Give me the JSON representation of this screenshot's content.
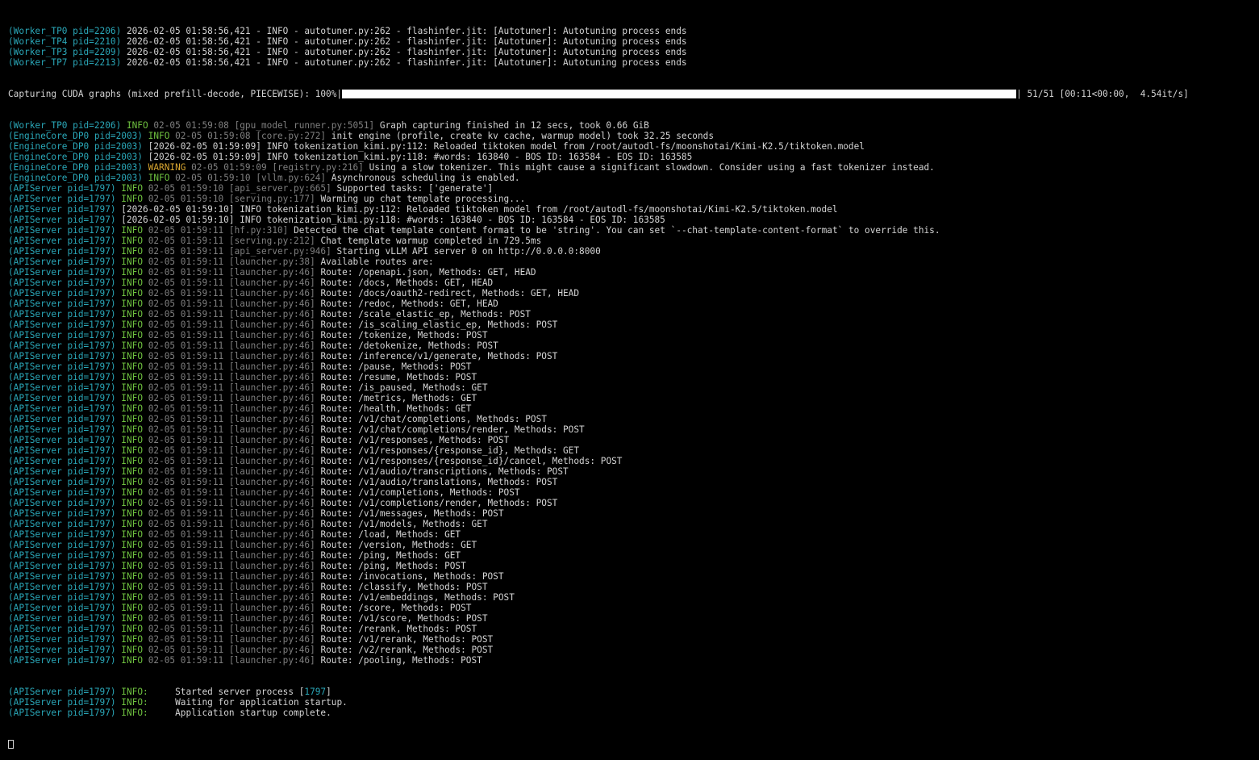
{
  "colors": {
    "background": "#000000",
    "text": "#d4d4d4",
    "source": "#2aa7b8",
    "info": "#6ec13f",
    "warning": "#d7a530",
    "dim": "#7f7f7f"
  },
  "worker_lines": [
    {
      "src": "(Worker_TP0 pid=2206)",
      "msg": " 2026-02-05 01:58:56,421 - INFO - autotuner.py:262 - flashinfer.jit: [Autotuner]: Autotuning process ends"
    },
    {
      "src": "(Worker_TP4 pid=2210)",
      "msg": " 2026-02-05 01:58:56,421 - INFO - autotuner.py:262 - flashinfer.jit: [Autotuner]: Autotuning process ends"
    },
    {
      "src": "(Worker_TP3 pid=2209)",
      "msg": " 2026-02-05 01:58:56,421 - INFO - autotuner.py:262 - flashinfer.jit: [Autotuner]: Autotuning process ends"
    },
    {
      "src": "(Worker_TP7 pid=2213)",
      "msg": " 2026-02-05 01:58:56,421 - INFO - autotuner.py:262 - flashinfer.jit: [Autotuner]: Autotuning process ends"
    }
  ],
  "progress": {
    "label": "Capturing CUDA graphs (mixed prefill-decode, PIECEWISE): 100%|",
    "fraction": 1.0,
    "stats": "| 51/51 [00:11<00:00,  4.54it/s]"
  },
  "log_lines": [
    {
      "src": "(Worker_TP0 pid=2206)",
      "level": "INFO",
      "ts": "02-05 01:59:08",
      "file": "[gpu_model_runner.py:5051]",
      "msg": "Graph capturing finished in 12 secs, took 0.66 GiB"
    },
    {
      "src": "(EngineCore_DP0 pid=2003)",
      "level": "INFO",
      "ts": "02-05 01:59:08",
      "file": "[core.py:272]",
      "msg": "init engine (profile, create kv cache, warmup model) took 32.25 seconds"
    },
    {
      "src": "(EngineCore_DP0 pid=2003)",
      "msg": " [2026-02-05 01:59:09] INFO tokenization_kimi.py:112: Reloaded tiktoken model from /root/autodl-fs/moonshotai/Kimi-K2.5/tiktoken.model"
    },
    {
      "src": "(EngineCore_DP0 pid=2003)",
      "msg": " [2026-02-05 01:59:09] INFO tokenization_kimi.py:118: #words: 163840 - BOS ID: 163584 - EOS ID: 163585"
    },
    {
      "src": "(EngineCore_DP0 pid=2003)",
      "level": "WARNING",
      "ts": "02-05 01:59:09",
      "file": "[registry.py:216]",
      "msg": "Using a slow tokenizer. This might cause a significant slowdown. Consider using a fast tokenizer instead."
    },
    {
      "src": "(EngineCore_DP0 pid=2003)",
      "level": "INFO",
      "ts": "02-05 01:59:10",
      "file": "[vllm.py:624]",
      "msg": "Asynchronous scheduling is enabled."
    },
    {
      "src": "(APIServer pid=1797)",
      "level": "INFO",
      "ts": "02-05 01:59:10",
      "file": "[api_server.py:665]",
      "msg": "Supported tasks: ['generate']"
    },
    {
      "src": "(APIServer pid=1797)",
      "level": "INFO",
      "ts": "02-05 01:59:10",
      "file": "[serving.py:177]",
      "msg": "Warming up chat template processing..."
    },
    {
      "src": "(APIServer pid=1797)",
      "msg": " [2026-02-05 01:59:10] INFO tokenization_kimi.py:112: Reloaded tiktoken model from /root/autodl-fs/moonshotai/Kimi-K2.5/tiktoken.model"
    },
    {
      "src": "(APIServer pid=1797)",
      "msg": " [2026-02-05 01:59:10] INFO tokenization_kimi.py:118: #words: 163840 - BOS ID: 163584 - EOS ID: 163585"
    },
    {
      "src": "(APIServer pid=1797)",
      "level": "INFO",
      "ts": "02-05 01:59:11",
      "file": "[hf.py:310]",
      "msg": "Detected the chat template content format to be 'string'. You can set `--chat-template-content-format` to override this."
    },
    {
      "src": "(APIServer pid=1797)",
      "level": "INFO",
      "ts": "02-05 01:59:11",
      "file": "[serving.py:212]",
      "msg": "Chat template warmup completed in 729.5ms"
    },
    {
      "src": "(APIServer pid=1797)",
      "level": "INFO",
      "ts": "02-05 01:59:11",
      "file": "[api_server.py:946]",
      "msg": "Starting vLLM API server 0 on http://0.0.0.0:8000"
    },
    {
      "src": "(APIServer pid=1797)",
      "level": "INFO",
      "ts": "02-05 01:59:11",
      "file": "[launcher.py:38]",
      "msg": "Available routes are:"
    },
    {
      "src": "(APIServer pid=1797)",
      "level": "INFO",
      "ts": "02-05 01:59:11",
      "file": "[launcher.py:46]",
      "msg": "Route: /openapi.json, Methods: GET, HEAD"
    },
    {
      "src": "(APIServer pid=1797)",
      "level": "INFO",
      "ts": "02-05 01:59:11",
      "file": "[launcher.py:46]",
      "msg": "Route: /docs, Methods: GET, HEAD"
    },
    {
      "src": "(APIServer pid=1797)",
      "level": "INFO",
      "ts": "02-05 01:59:11",
      "file": "[launcher.py:46]",
      "msg": "Route: /docs/oauth2-redirect, Methods: GET, HEAD"
    },
    {
      "src": "(APIServer pid=1797)",
      "level": "INFO",
      "ts": "02-05 01:59:11",
      "file": "[launcher.py:46]",
      "msg": "Route: /redoc, Methods: GET, HEAD"
    },
    {
      "src": "(APIServer pid=1797)",
      "level": "INFO",
      "ts": "02-05 01:59:11",
      "file": "[launcher.py:46]",
      "msg": "Route: /scale_elastic_ep, Methods: POST"
    },
    {
      "src": "(APIServer pid=1797)",
      "level": "INFO",
      "ts": "02-05 01:59:11",
      "file": "[launcher.py:46]",
      "msg": "Route: /is_scaling_elastic_ep, Methods: POST"
    },
    {
      "src": "(APIServer pid=1797)",
      "level": "INFO",
      "ts": "02-05 01:59:11",
      "file": "[launcher.py:46]",
      "msg": "Route: /tokenize, Methods: POST"
    },
    {
      "src": "(APIServer pid=1797)",
      "level": "INFO",
      "ts": "02-05 01:59:11",
      "file": "[launcher.py:46]",
      "msg": "Route: /detokenize, Methods: POST"
    },
    {
      "src": "(APIServer pid=1797)",
      "level": "INFO",
      "ts": "02-05 01:59:11",
      "file": "[launcher.py:46]",
      "msg": "Route: /inference/v1/generate, Methods: POST"
    },
    {
      "src": "(APIServer pid=1797)",
      "level": "INFO",
      "ts": "02-05 01:59:11",
      "file": "[launcher.py:46]",
      "msg": "Route: /pause, Methods: POST"
    },
    {
      "src": "(APIServer pid=1797)",
      "level": "INFO",
      "ts": "02-05 01:59:11",
      "file": "[launcher.py:46]",
      "msg": "Route: /resume, Methods: POST"
    },
    {
      "src": "(APIServer pid=1797)",
      "level": "INFO",
      "ts": "02-05 01:59:11",
      "file": "[launcher.py:46]",
      "msg": "Route: /is_paused, Methods: GET"
    },
    {
      "src": "(APIServer pid=1797)",
      "level": "INFO",
      "ts": "02-05 01:59:11",
      "file": "[launcher.py:46]",
      "msg": "Route: /metrics, Methods: GET"
    },
    {
      "src": "(APIServer pid=1797)",
      "level": "INFO",
      "ts": "02-05 01:59:11",
      "file": "[launcher.py:46]",
      "msg": "Route: /health, Methods: GET"
    },
    {
      "src": "(APIServer pid=1797)",
      "level": "INFO",
      "ts": "02-05 01:59:11",
      "file": "[launcher.py:46]",
      "msg": "Route: /v1/chat/completions, Methods: POST"
    },
    {
      "src": "(APIServer pid=1797)",
      "level": "INFO",
      "ts": "02-05 01:59:11",
      "file": "[launcher.py:46]",
      "msg": "Route: /v1/chat/completions/render, Methods: POST"
    },
    {
      "src": "(APIServer pid=1797)",
      "level": "INFO",
      "ts": "02-05 01:59:11",
      "file": "[launcher.py:46]",
      "msg": "Route: /v1/responses, Methods: POST"
    },
    {
      "src": "(APIServer pid=1797)",
      "level": "INFO",
      "ts": "02-05 01:59:11",
      "file": "[launcher.py:46]",
      "msg": "Route: /v1/responses/{response_id}, Methods: GET"
    },
    {
      "src": "(APIServer pid=1797)",
      "level": "INFO",
      "ts": "02-05 01:59:11",
      "file": "[launcher.py:46]",
      "msg": "Route: /v1/responses/{response_id}/cancel, Methods: POST"
    },
    {
      "src": "(APIServer pid=1797)",
      "level": "INFO",
      "ts": "02-05 01:59:11",
      "file": "[launcher.py:46]",
      "msg": "Route: /v1/audio/transcriptions, Methods: POST"
    },
    {
      "src": "(APIServer pid=1797)",
      "level": "INFO",
      "ts": "02-05 01:59:11",
      "file": "[launcher.py:46]",
      "msg": "Route: /v1/audio/translations, Methods: POST"
    },
    {
      "src": "(APIServer pid=1797)",
      "level": "INFO",
      "ts": "02-05 01:59:11",
      "file": "[launcher.py:46]",
      "msg": "Route: /v1/completions, Methods: POST"
    },
    {
      "src": "(APIServer pid=1797)",
      "level": "INFO",
      "ts": "02-05 01:59:11",
      "file": "[launcher.py:46]",
      "msg": "Route: /v1/completions/render, Methods: POST"
    },
    {
      "src": "(APIServer pid=1797)",
      "level": "INFO",
      "ts": "02-05 01:59:11",
      "file": "[launcher.py:46]",
      "msg": "Route: /v1/messages, Methods: POST"
    },
    {
      "src": "(APIServer pid=1797)",
      "level": "INFO",
      "ts": "02-05 01:59:11",
      "file": "[launcher.py:46]",
      "msg": "Route: /v1/models, Methods: GET"
    },
    {
      "src": "(APIServer pid=1797)",
      "level": "INFO",
      "ts": "02-05 01:59:11",
      "file": "[launcher.py:46]",
      "msg": "Route: /load, Methods: GET"
    },
    {
      "src": "(APIServer pid=1797)",
      "level": "INFO",
      "ts": "02-05 01:59:11",
      "file": "[launcher.py:46]",
      "msg": "Route: /version, Methods: GET"
    },
    {
      "src": "(APIServer pid=1797)",
      "level": "INFO",
      "ts": "02-05 01:59:11",
      "file": "[launcher.py:46]",
      "msg": "Route: /ping, Methods: GET"
    },
    {
      "src": "(APIServer pid=1797)",
      "level": "INFO",
      "ts": "02-05 01:59:11",
      "file": "[launcher.py:46]",
      "msg": "Route: /ping, Methods: POST"
    },
    {
      "src": "(APIServer pid=1797)",
      "level": "INFO",
      "ts": "02-05 01:59:11",
      "file": "[launcher.py:46]",
      "msg": "Route: /invocations, Methods: POST"
    },
    {
      "src": "(APIServer pid=1797)",
      "level": "INFO",
      "ts": "02-05 01:59:11",
      "file": "[launcher.py:46]",
      "msg": "Route: /classify, Methods: POST"
    },
    {
      "src": "(APIServer pid=1797)",
      "level": "INFO",
      "ts": "02-05 01:59:11",
      "file": "[launcher.py:46]",
      "msg": "Route: /v1/embeddings, Methods: POST"
    },
    {
      "src": "(APIServer pid=1797)",
      "level": "INFO",
      "ts": "02-05 01:59:11",
      "file": "[launcher.py:46]",
      "msg": "Route: /score, Methods: POST"
    },
    {
      "src": "(APIServer pid=1797)",
      "level": "INFO",
      "ts": "02-05 01:59:11",
      "file": "[launcher.py:46]",
      "msg": "Route: /v1/score, Methods: POST"
    },
    {
      "src": "(APIServer pid=1797)",
      "level": "INFO",
      "ts": "02-05 01:59:11",
      "file": "[launcher.py:46]",
      "msg": "Route: /rerank, Methods: POST"
    },
    {
      "src": "(APIServer pid=1797)",
      "level": "INFO",
      "ts": "02-05 01:59:11",
      "file": "[launcher.py:46]",
      "msg": "Route: /v1/rerank, Methods: POST"
    },
    {
      "src": "(APIServer pid=1797)",
      "level": "INFO",
      "ts": "02-05 01:59:11",
      "file": "[launcher.py:46]",
      "msg": "Route: /v2/rerank, Methods: POST"
    },
    {
      "src": "(APIServer pid=1797)",
      "level": "INFO",
      "ts": "02-05 01:59:11",
      "file": "[launcher.py:46]",
      "msg": "Route: /pooling, Methods: POST"
    }
  ],
  "uvicorn_lines": [
    {
      "src": "(APIServer pid=1797)",
      "level": "INFO:",
      "msg_before": "     Started server process [",
      "pid": "1797",
      "msg_after": "]"
    },
    {
      "src": "(APIServer pid=1797)",
      "level": "INFO:",
      "msg_before": "     Waiting for application startup.",
      "pid": "",
      "msg_after": ""
    },
    {
      "src": "(APIServer pid=1797)",
      "level": "INFO:",
      "msg_before": "     Application startup complete.",
      "pid": "",
      "msg_after": ""
    }
  ]
}
